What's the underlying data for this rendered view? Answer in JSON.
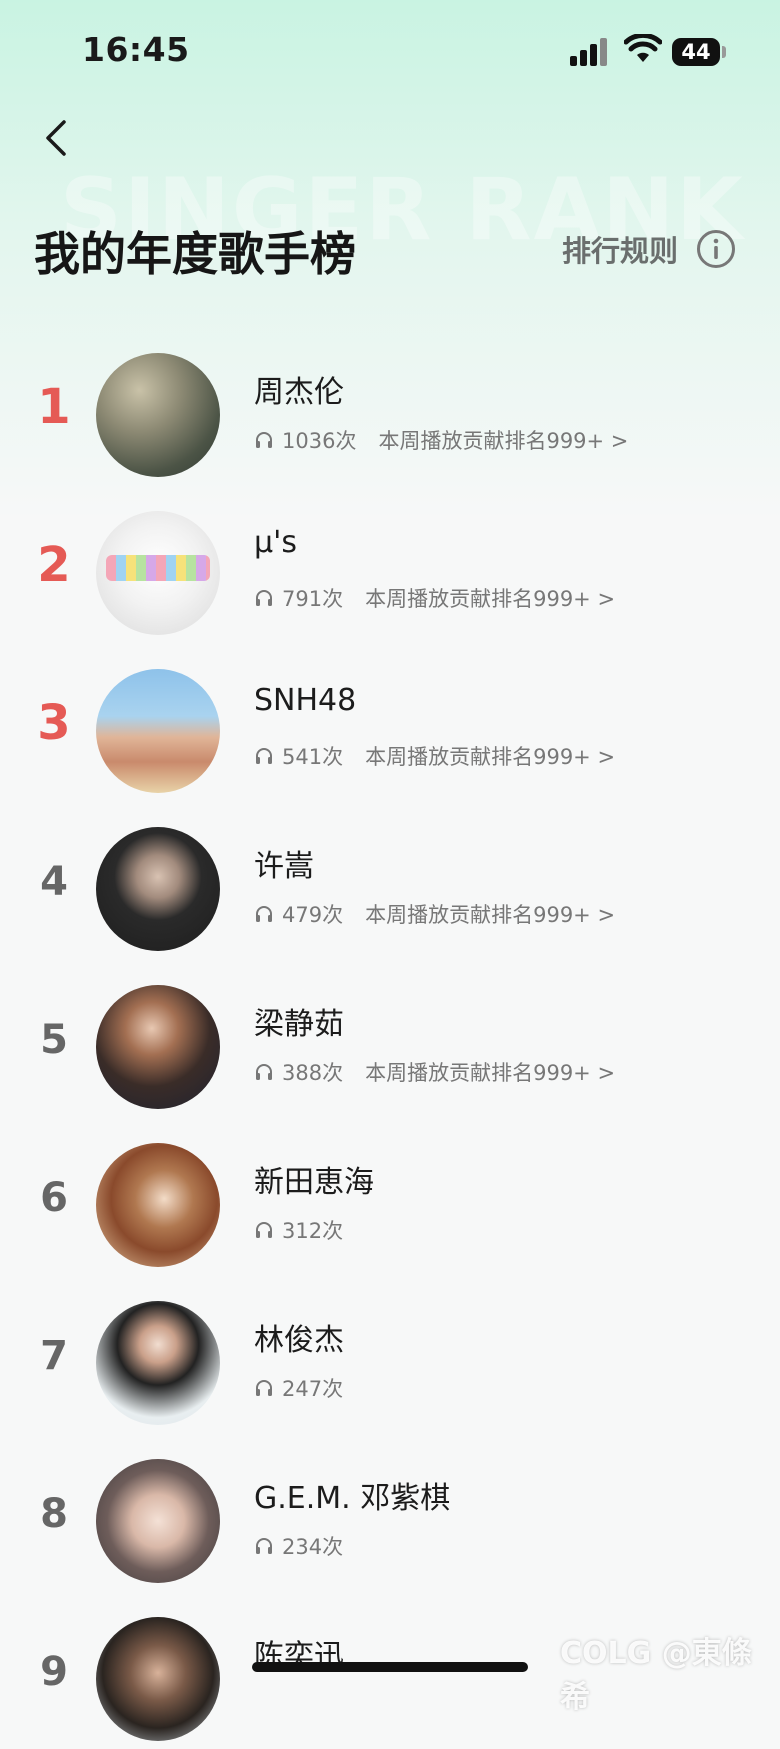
{
  "status_bar": {
    "time": "16:45",
    "battery": "44"
  },
  "header": {
    "watermark": "SINGER RANK",
    "title": "我的年度歌手榜",
    "rules_label": "排行规则"
  },
  "rankings": [
    {
      "rank": "1",
      "name": "周杰伦",
      "plays": "1036次",
      "weekly": "本周播放贡献排名999+ >"
    },
    {
      "rank": "2",
      "name": "μ's",
      "plays": "791次",
      "weekly": "本周播放贡献排名999+ >"
    },
    {
      "rank": "3",
      "name": "SNH48",
      "plays": "541次",
      "weekly": "本周播放贡献排名999+ >"
    },
    {
      "rank": "4",
      "name": "许嵩",
      "plays": "479次",
      "weekly": "本周播放贡献排名999+ >"
    },
    {
      "rank": "5",
      "name": "梁静茹",
      "plays": "388次",
      "weekly": "本周播放贡献排名999+ >"
    },
    {
      "rank": "6",
      "name": "新田恵海",
      "plays": "312次",
      "weekly": ""
    },
    {
      "rank": "7",
      "name": "林俊杰",
      "plays": "247次",
      "weekly": ""
    },
    {
      "rank": "8",
      "name": "G.E.M. 邓紫棋",
      "plays": "234次",
      "weekly": ""
    },
    {
      "rank": "9",
      "name": "陈奕迅",
      "plays": "",
      "weekly": ""
    }
  ],
  "footer": {
    "watermark": "COLG @東條希"
  },
  "colors": {
    "accent_rank": "#e55a55",
    "header_gradient_top": "#c9f3e2"
  }
}
